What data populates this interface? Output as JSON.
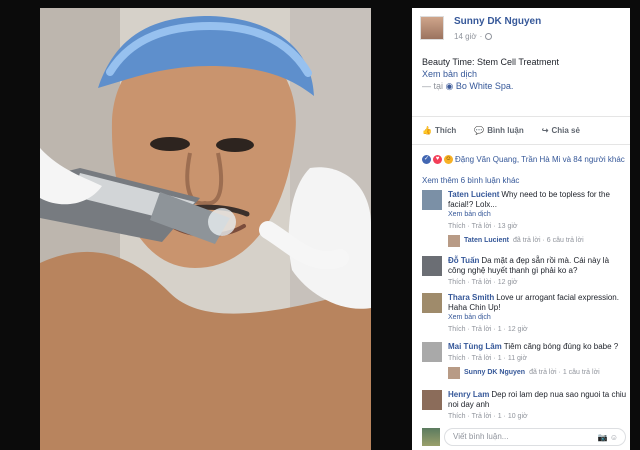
{
  "post": {
    "author": "Sunny DK Nguyen",
    "time": "14 giờ",
    "text": "Beauty Time: Stem Cell Treatment",
    "translate": "Xem bản dịch",
    "place_prefix": "— tại",
    "place": "Bo White Spa."
  },
  "actions": {
    "like": "Thích",
    "comment": "Bình luận",
    "share": "Chia sẻ"
  },
  "reactions_text": "Đặng Văn Quang, Trần Hà Mi và 84 người khác",
  "more_comments": "Xem thêm 6 bình luận khác",
  "comments": [
    {
      "name": "Taten Lucient",
      "text": "Why need to be topless for the facial!? Lolx...",
      "translate": "Xem bản dịch",
      "meta": "Thích · Trả lời · 13 giờ",
      "reply_name": "Taten Lucient",
      "reply_text": "đã trả lời · 6 câu trả lời"
    },
    {
      "name": "Đỗ Tuấn",
      "text": "Da mặt a đẹp sẵn rồi mà. Cái này là công nghệ huyết thanh gì phải ko a?",
      "translate": "",
      "meta": "Thích · Trả lời · 12 giờ",
      "reply_name": "",
      "reply_text": ""
    },
    {
      "name": "Thara Smith",
      "text": "Love ur arrogant facial expression. Haha Chin Up!",
      "translate": "Xem bản dịch",
      "meta": "Thích · Trả lời · 1 · 12 giờ",
      "reply_name": "",
      "reply_text": ""
    },
    {
      "name": "Mai Tùng Lâm",
      "text": "Tiêm căng bóng đúng ko babe ?",
      "translate": "",
      "meta": "Thích · Trả lời · 1 · 11 giờ",
      "reply_name": "Sunny DK Nguyen",
      "reply_text": "đã trả lời · 1 câu trả lời"
    },
    {
      "name": "Henry Lam",
      "text": "Dep roi lam dep nua sao nguoi ta chiu noi day anh",
      "translate": "",
      "meta": "Thích · Trả lời · 1 · 10 giờ",
      "reply_name": "",
      "reply_text": ""
    }
  ],
  "compose": {
    "placeholder": "Viết bình luận..."
  },
  "colors": {
    "link": "#365899",
    "muted": "#90949c"
  }
}
